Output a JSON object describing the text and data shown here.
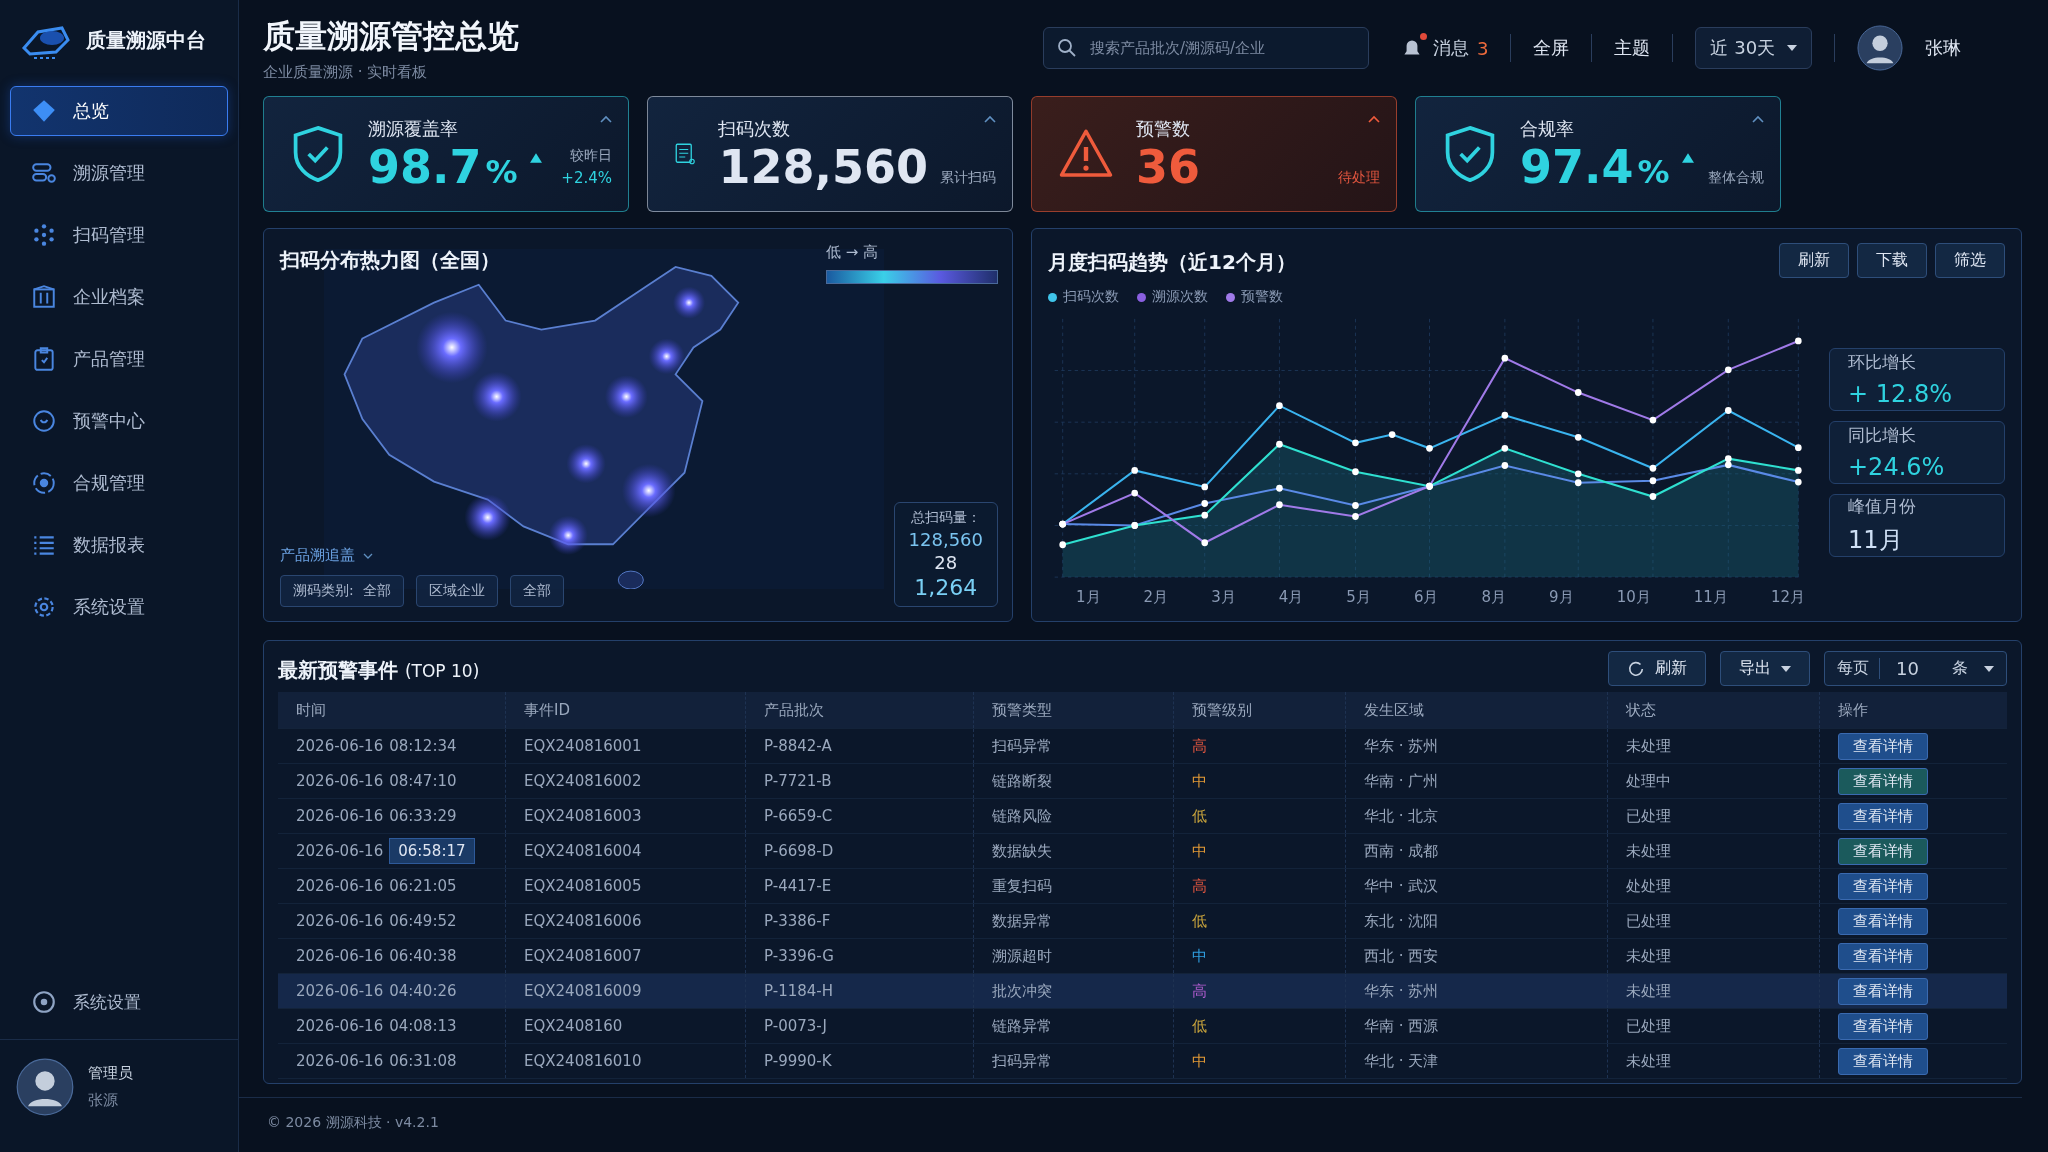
{
  "brand": {
    "name": "质量溯源中台"
  },
  "header": {
    "title": "质量溯源管控总览",
    "subtitle": "企业质量溯源 · 实时看板",
    "search": {
      "placeholder": "搜索产品批次/溯源码/企业"
    },
    "messages": {
      "label": "消息",
      "count": "3",
      "unread": true
    },
    "fullscreen": "全屏",
    "theme": "主题",
    "range": "近 30天",
    "user": "张琳"
  },
  "sidebar": {
    "items": [
      {
        "label": "总览",
        "selected": true
      },
      {
        "label": "溯源管理",
        "selected": false
      },
      {
        "label": "扫码管理",
        "selected": false
      },
      {
        "label": "企业档案",
        "selected": false
      },
      {
        "label": "产品管理",
        "selected": false
      },
      {
        "label": "预警中心",
        "selected": false
      },
      {
        "label": "合规管理",
        "selected": false
      },
      {
        "label": "数据报表",
        "selected": false
      },
      {
        "label": "系统设置",
        "selected": false
      }
    ],
    "bottom_item": {
      "label": "系统设置"
    },
    "user": {
      "role": "管理员",
      "name": "张源"
    }
  },
  "kpis": [
    {
      "kind": "shield",
      "title": "溯源覆盖率",
      "value": "98.7",
      "unit": "%",
      "color": "#2fd3e0",
      "trend_up": true,
      "note": "较昨日",
      "delta": "+2.4%"
    },
    {
      "kind": "scan",
      "title": "扫码次数",
      "value": "128,560",
      "color": "#dfe6f2",
      "trend_up": false,
      "note": "累计扫码"
    },
    {
      "kind": "warning",
      "title": "预警数",
      "value": "36",
      "color": "#ef5b3c",
      "trend_up": false,
      "note": "待处理"
    },
    {
      "kind": "shield",
      "title": "合规率",
      "value": "97.4",
      "unit": "%",
      "color": "#2fd3e0",
      "trend_up": true,
      "note": "整体合规"
    }
  ],
  "map_panel": {
    "title": "扫码分布热力图（全国）",
    "legend": "低 → 高",
    "filter_label": "产品溯追盖",
    "chips": [
      "溯码类别:  全部",
      "区域企业",
      "全部"
    ],
    "totals": {
      "label": "总扫码量：",
      "values": [
        "128,560",
        "28",
        "1,264"
      ]
    }
  },
  "trend_panel": {
    "title": "月度扫码趋势（近12个月）",
    "buttons": [
      "刷新",
      "下载",
      "筛选"
    ],
    "legend": [
      {
        "label": "扫码次数",
        "color": "#3fc4ea"
      },
      {
        "label": "溯源次数",
        "color": "#8a5fe0"
      },
      {
        "label": "预警数",
        "color": "#a07ae8"
      }
    ],
    "months": [
      "1月",
      "2月",
      "3月",
      "4月",
      "5月",
      "6月",
      "8月",
      "9月",
      "10月",
      "11月",
      "12月"
    ],
    "stats": [
      {
        "label": "环比增长",
        "value": "+ 12.8%"
      },
      {
        "label": "同比增长",
        "value": "+24.6%"
      },
      {
        "label": "峰值月份",
        "value": "11月"
      }
    ]
  },
  "events": {
    "title": "最新预警事件",
    "title_suffix": "(TOP 10)",
    "refresh": "刷新",
    "export": "导出",
    "page_size": {
      "prefix": "每页",
      "value": "10",
      "suffix": "条"
    },
    "columns": [
      "时间",
      "事件ID",
      "产品批次",
      "预警类型",
      "预警级别",
      "发生区域",
      "状态",
      "操作"
    ],
    "rows": [
      {
        "date": "2026-06-16",
        "clock": "08:12:34",
        "clock_selected": false,
        "selected": false,
        "id": "EQX240816001",
        "batch": "P-8842-A",
        "type": "扫码异常",
        "level": {
          "text": "高",
          "color": "#e0553f"
        },
        "region": "华东 · 苏州",
        "status": "未处理",
        "action": {
          "label": "查看详情",
          "color": "#1f4e8c"
        }
      },
      {
        "date": "2026-06-16",
        "clock": "08:47:10",
        "clock_selected": false,
        "selected": false,
        "id": "EQX240816002",
        "batch": "P-7721-B",
        "type": "链路断裂",
        "level": {
          "text": "中",
          "color": "#e39a36"
        },
        "region": "华南 · 广州",
        "status": "处理中",
        "action": {
          "label": "查看详情",
          "color": "#1b5a5c"
        }
      },
      {
        "date": "2026-06-16",
        "clock": "06:33:29",
        "clock_selected": false,
        "selected": false,
        "id": "EQX240816003",
        "batch": "P-6659-C",
        "type": "链路风险",
        "level": {
          "text": "低",
          "color": "#c9a43c"
        },
        "region": "华北 · 北京",
        "status": "已处理",
        "action": {
          "label": "查看详情",
          "color": "#1f4e8c"
        }
      },
      {
        "date": "2026-06-16",
        "clock": "06:58:17",
        "clock_selected": true,
        "selected": false,
        "id": "EQX240816004",
        "batch": "P-6698-D",
        "type": "数据缺失",
        "level": {
          "text": "中",
          "color": "#e39a36"
        },
        "region": "西南 · 成都",
        "status": "未处理",
        "action": {
          "label": "查看详情",
          "color": "#1b5a5c"
        }
      },
      {
        "date": "2026-06-16",
        "clock": "06:21:05",
        "clock_selected": false,
        "selected": false,
        "id": "EQX240816005",
        "batch": "P-4417-E",
        "type": "重复扫码",
        "level": {
          "text": "高",
          "color": "#e0553f"
        },
        "region": "华中 · 武汉",
        "status": "处处理",
        "action": {
          "label": "查看详情",
          "color": "#1f4e8c"
        }
      },
      {
        "date": "2026-06-16",
        "clock": "06:49:52",
        "clock_selected": false,
        "selected": false,
        "id": "EQX240816006",
        "batch": "P-3386-F",
        "type": "数据异常",
        "level": {
          "text": "低",
          "color": "#c9a43c"
        },
        "region": "东北 · 沈阳",
        "status": "已处理",
        "action": {
          "label": "查看详情",
          "color": "#1f4e8c"
        }
      },
      {
        "date": "2026-06-16",
        "clock": "06:40:38",
        "clock_selected": false,
        "selected": false,
        "id": "EQX240816007",
        "batch": "P-3396-G",
        "type": "溯源超时",
        "level": {
          "text": "中",
          "color": "#2f9ee0"
        },
        "region": "西北 · 西安",
        "status": "未处理",
        "action": {
          "label": "查看详情",
          "color": "#1f4e8c"
        }
      },
      {
        "date": "2026-06-16",
        "clock": "04:40:26",
        "clock_selected": false,
        "selected": true,
        "id": "EQX240816009",
        "batch": "P-1184-H",
        "type": "批次冲突",
        "level": {
          "text": "高",
          "color": "#b05ccf"
        },
        "region": "华东 · 苏州",
        "status": "未处理",
        "action": {
          "label": "查看详情",
          "color": "#1f4e8c"
        }
      },
      {
        "date": "2026-06-16",
        "clock": "04:08:13",
        "clock_selected": false,
        "selected": false,
        "id": "EQX2408160",
        "batch": "P-0073-J",
        "type": "链路异常",
        "level": {
          "text": "低",
          "color": "#c9a43c"
        },
        "region": "华南 · 西源",
        "status": "已处理",
        "action": {
          "label": "查看详情",
          "color": "#1f4e8c"
        }
      },
      {
        "date": "2026-06-16",
        "clock": "06:31:08",
        "clock_selected": false,
        "selected": false,
        "id": "EQX240816010",
        "batch": "P-9990-K",
        "type": "扫码异常",
        "level": {
          "text": "中",
          "color": "#e39a36"
        },
        "region": "华北 · 天津",
        "status": "未处理",
        "action": {
          "label": "查看详情",
          "color": "#1f4e8c"
        }
      }
    ]
  },
  "footer": "© 2026 溯源科技 · v4.2.1"
}
